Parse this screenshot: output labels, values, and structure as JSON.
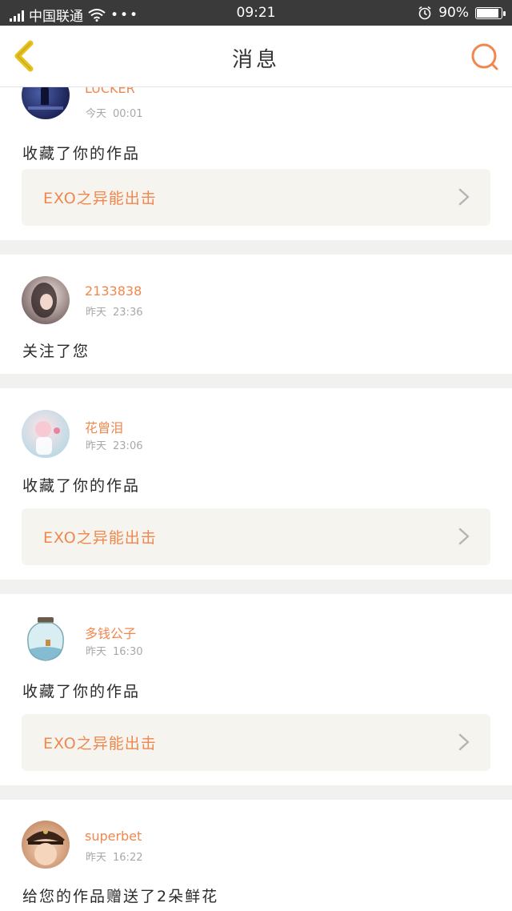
{
  "status_bar": {
    "carrier": "中国联通",
    "dots": "•••",
    "time": "09:21",
    "battery": "90%",
    "battery_level": 0.9
  },
  "header": {
    "title": "消息"
  },
  "colors": {
    "accent": "#f0874e",
    "back_arrow": "#e8c21c",
    "divider": "#f1f1ef"
  },
  "notifications": [
    {
      "user": "LUCKER",
      "date": "今天",
      "time": "00:01",
      "action": "收藏了你的作品",
      "work": "EXO之异能出击"
    },
    {
      "user": "2133838",
      "date": "昨天",
      "time": "23:36",
      "action": "关注了您"
    },
    {
      "user": "花曾泪",
      "date": "昨天",
      "time": "23:06",
      "action": "收藏了你的作品",
      "work": "EXO之异能出击"
    },
    {
      "user": "多钱公子",
      "date": "昨天",
      "time": "16:30",
      "action": "收藏了你的作品",
      "work": "EXO之异能出击"
    },
    {
      "user": "superbet",
      "date": "昨天",
      "time": "16:22",
      "action": "给您的作品赠送了2朵鲜花"
    }
  ]
}
